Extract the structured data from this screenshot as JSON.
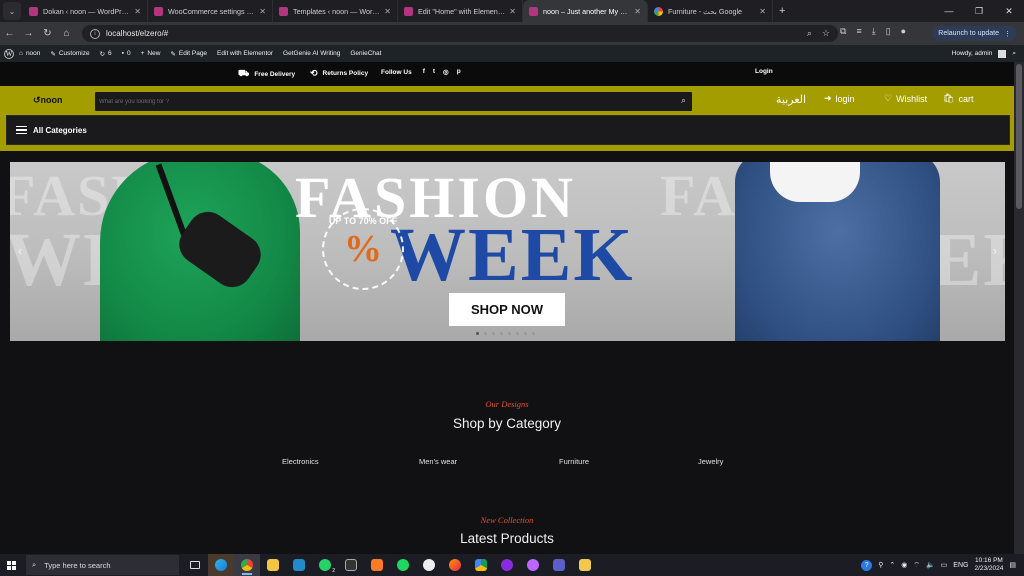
{
  "browser": {
    "tabs": [
      {
        "title": "Dokan ‹ noon — WordPress",
        "icon": "woo"
      },
      {
        "title": "WooCommerce settings ‹ noon ·",
        "icon": "woo"
      },
      {
        "title": "Templates ‹ noon — WordPress",
        "icon": "woo"
      },
      {
        "title": "Edit \"Home\" with Elementor",
        "icon": "woo"
      },
      {
        "title": "noon – Just another My Blog si",
        "icon": "woo"
      },
      {
        "title": "Furniture - بحث Google",
        "icon": "google"
      }
    ],
    "url": "localhost/elzero/#",
    "relaunch_label": "Relaunch to update"
  },
  "wp_admin_bar": {
    "site": "noon",
    "customize": "Customize",
    "updates": "6",
    "comments": "0",
    "new": "New",
    "edit_page": "Edit Page",
    "edit_elementor": "Edit with Elementor",
    "getgenie": "GetGenie AI Writing",
    "geniechat": "GenieChat",
    "howdy": "Howdy, admin"
  },
  "top_strip": {
    "free_delivery": "Free Delivery",
    "returns_policy": "Returns Policy",
    "follow_us": "Follow Us",
    "social": [
      "f",
      "t",
      "◎",
      "p"
    ],
    "login": "Login"
  },
  "header": {
    "logo": "noon",
    "search_placeholder": "What are you looking for ?",
    "arabic": "العربية",
    "login": "login",
    "wishlist": "Wishlist",
    "cart": "cart",
    "all_categories": "All Categories"
  },
  "hero": {
    "headline_top": "FASHION",
    "headline_main": "WEEK",
    "badge_text": "UP TO 70% OFF",
    "badge_symbol": "%",
    "cta": "SHOP NOW",
    "slides": 8,
    "active_slide": 1
  },
  "categories_section": {
    "eyebrow": "Our Designs",
    "title": "Shop by Category",
    "items": [
      "Electronics",
      "Men's wear",
      "Furniture",
      "Jewelry"
    ]
  },
  "products_section": {
    "eyebrow": "New Collection",
    "title": "Latest Products"
  },
  "taskbar": {
    "search_placeholder": "Type here to search",
    "lang": "ENG",
    "time": "10:16 PM",
    "date": "2/23/2024",
    "whatsapp_badge": "2"
  },
  "colors": {
    "header_bg": "#a49d00",
    "accent_italic": "#e0522a",
    "hero_blue": "#1e4aa5"
  }
}
